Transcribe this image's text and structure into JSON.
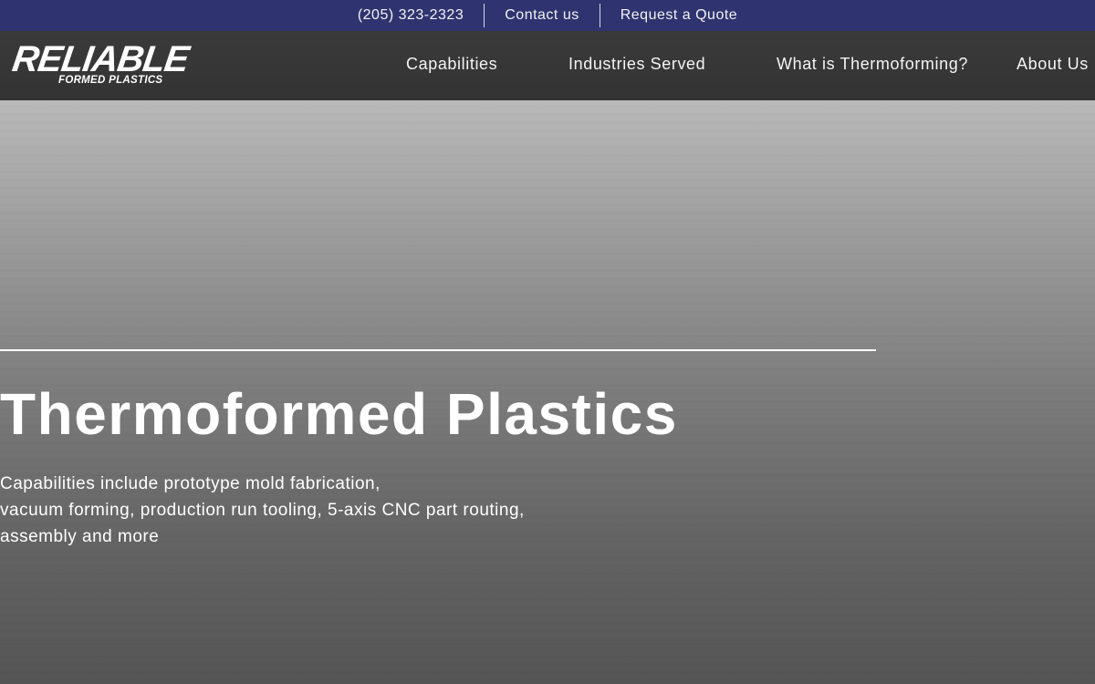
{
  "topbar": {
    "phone": "(205) 323-2323",
    "contact": "Contact us",
    "quote": "Request a Quote"
  },
  "header": {
    "logo": {
      "word": "RELIABLE",
      "sub": "FORMED PLASTICS"
    },
    "nav": [
      {
        "label": "Capabilities"
      },
      {
        "label": "Industries Served"
      },
      {
        "label": "What is Thermoforming?"
      },
      {
        "label": "About Us"
      }
    ]
  },
  "hero": {
    "title": "Thermoformed Plastics",
    "description_lines": [
      "Capabilities include prototype mold fabrication,",
      "vacuum forming, production run tooling, 5-axis CNC part routing,",
      "assembly and more"
    ]
  },
  "colors": {
    "topbar": "#2f3470",
    "header": "#363636",
    "text": "#ffffff"
  }
}
